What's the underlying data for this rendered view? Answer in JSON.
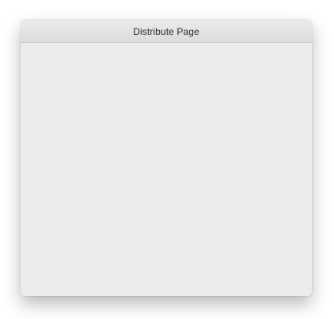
{
  "window": {
    "title": "Distribute Page"
  },
  "colors": {
    "background": "#ffffff",
    "window_body": "#ececec",
    "titlebar_top": "#ebebeb",
    "titlebar_bottom": "#dcdcdc",
    "title_text": "#2a2a2a"
  }
}
